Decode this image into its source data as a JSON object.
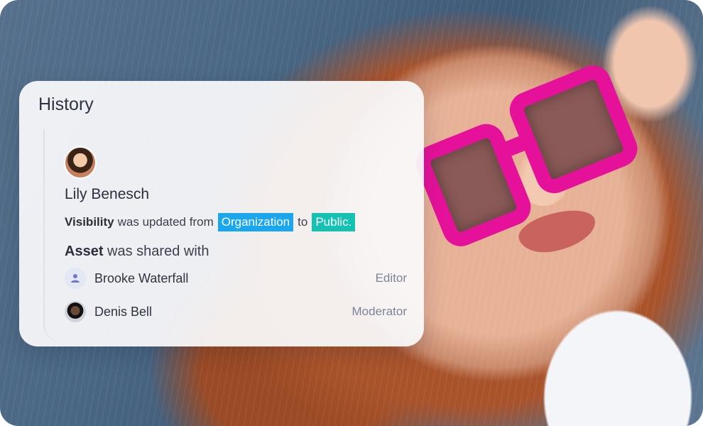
{
  "card": {
    "title": "History",
    "entry": {
      "user_name": "Lily Benesch",
      "visibility_label": "Visibility",
      "updated_text": "was updated from",
      "from_value": "Organization",
      "to_text": "to",
      "to_value": "Public.",
      "asset_label": "Asset",
      "shared_text": "was shared with",
      "shared_with": [
        {
          "name": "Brooke Waterfall",
          "role": "Editor",
          "avatar": "user-icon"
        },
        {
          "name": "Denis Bell",
          "role": "Moderator",
          "avatar": "photo"
        }
      ]
    }
  },
  "colors": {
    "organization_pill": "#1aa7f0",
    "public_pill": "#15c1b2",
    "glasses": "#e6119a"
  }
}
